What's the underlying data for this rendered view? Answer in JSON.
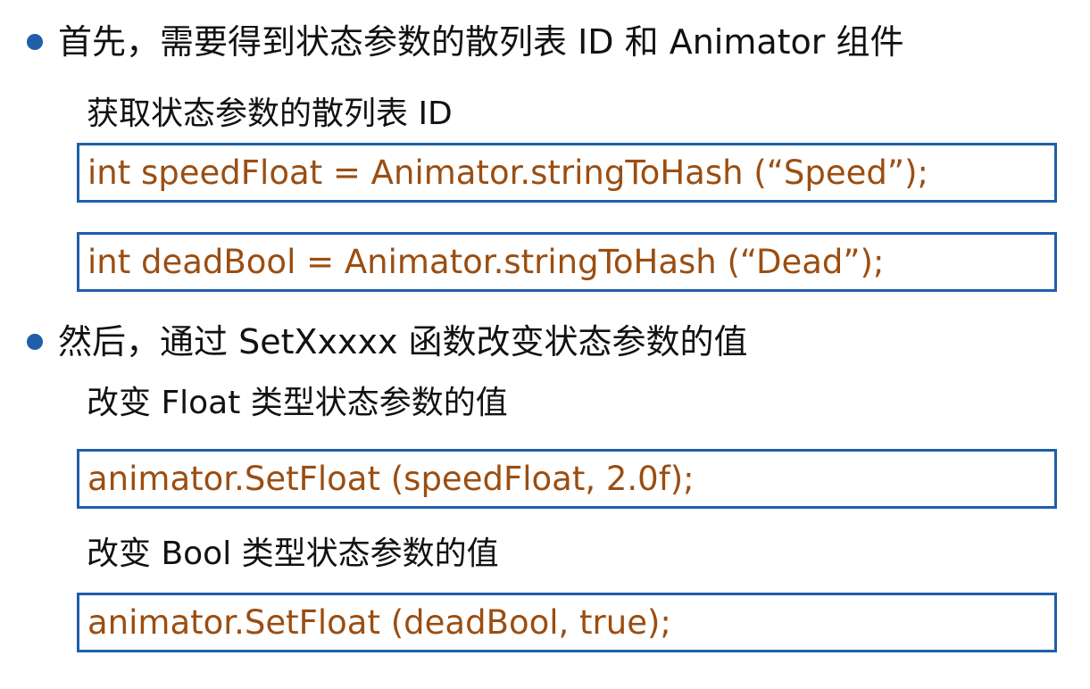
{
  "section1": {
    "bullet_text": "首先，需要得到状态参数的散列表 ID 和 Animator 组件",
    "subheading": "获取状态参数的散列表 ID",
    "code_lines": [
      "int speedFloat = Animator.stringToHash (“Speed”);",
      "int deadBool = Animator.stringToHash (“Dead”);"
    ]
  },
  "section2": {
    "bullet_text": "然后，通过 SetXxxxx 函数改变状态参数的值",
    "float_subheading": "改变 Float 类型状态参数的值",
    "float_code": "animator.SetFloat (speedFloat, 2.0f);",
    "bool_subheading": "改变 Bool 类型状态参数的值",
    "bool_code": "animator.SetFloat (deadBool, true);"
  },
  "colors": {
    "bullet": "#1f5fa8",
    "box_border": "#1f5fa8",
    "code_text": "#9a4e12",
    "body_text": "#111111"
  }
}
